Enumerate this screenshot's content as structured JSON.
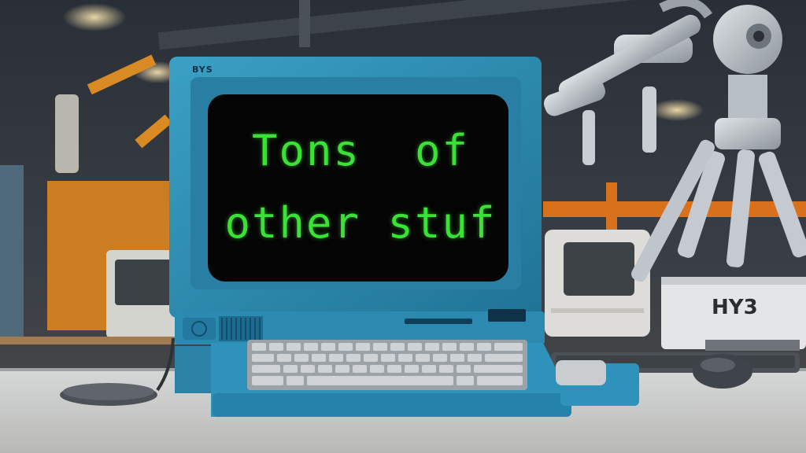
{
  "monitor": {
    "brand_label": "BYS",
    "screen_text": [
      "Tons  of",
      "other stuf"
    ]
  },
  "robot": {
    "box_label": "HY3"
  },
  "colors": {
    "computer_blue": "#2e8fb4",
    "screen_background": "#050505",
    "screen_text": "#3be236",
    "workshop_orange": "#e58a1c"
  }
}
